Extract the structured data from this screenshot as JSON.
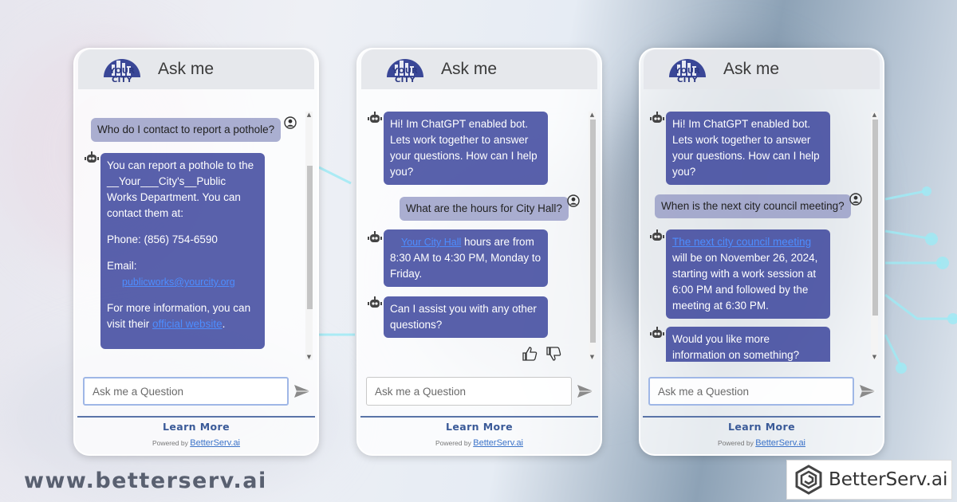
{
  "footer": {
    "website": "www.betterserv.ai",
    "brand": "BetterServ.ai"
  },
  "widget": {
    "logo_text": "YOUR CITY",
    "title": "Ask me",
    "input_placeholder": "Ask me a Question",
    "learn_more": "Learn More",
    "powered_prefix": "Powered by",
    "powered_link": "BetterServ.ai"
  },
  "panel1": {
    "user_question": "Who do I contact to report a pothole?",
    "bot_line1": "You can report a pothole to the __Your___City's__Public Works Department. You can contact them at:",
    "bot_phone": "Phone: (856) 754-6590",
    "bot_email_label": "Email:",
    "bot_email": "publicworks@yourcity.org",
    "bot_more_prefix": "For more information, you can visit their",
    "bot_more_link": "official website",
    "bot_more_suffix": "."
  },
  "panel2": {
    "greeting": "Hi! Im ChatGPT enabled bot. Lets work together to answer your questions. How can I help you?",
    "user_question": "What are the hours for City Hall?",
    "bot_hours_link": "Your City Hall",
    "bot_hours_text": "hours are from 8:30 AM to 4:30 PM, Monday to Friday.",
    "bot_assist": "Can I assist you with any other questions?"
  },
  "panel3": {
    "greeting": "Hi! Im ChatGPT enabled bot. Lets work together to answer your questions. How can I help you?",
    "user_question": "When is the next city council meeting?",
    "bot_meeting_link": "The next city council meeting",
    "bot_meeting_text": "will be on November 26, 2024, starting with a work session at 6:00 PM and followed by the meeting at 6:30 PM.",
    "bot_more": "Would you like more information on something?"
  },
  "icons": {
    "user": "user-avatar-icon",
    "bot": "robot-icon",
    "send": "send-icon",
    "thumbs_up": "thumbs-up-icon",
    "thumbs_down": "thumbs-down-icon"
  },
  "colors": {
    "bot_bubble": "#343e98",
    "user_bubble": "#9498c4",
    "link": "#4d8dff",
    "learn_more": "#3a5a98"
  }
}
